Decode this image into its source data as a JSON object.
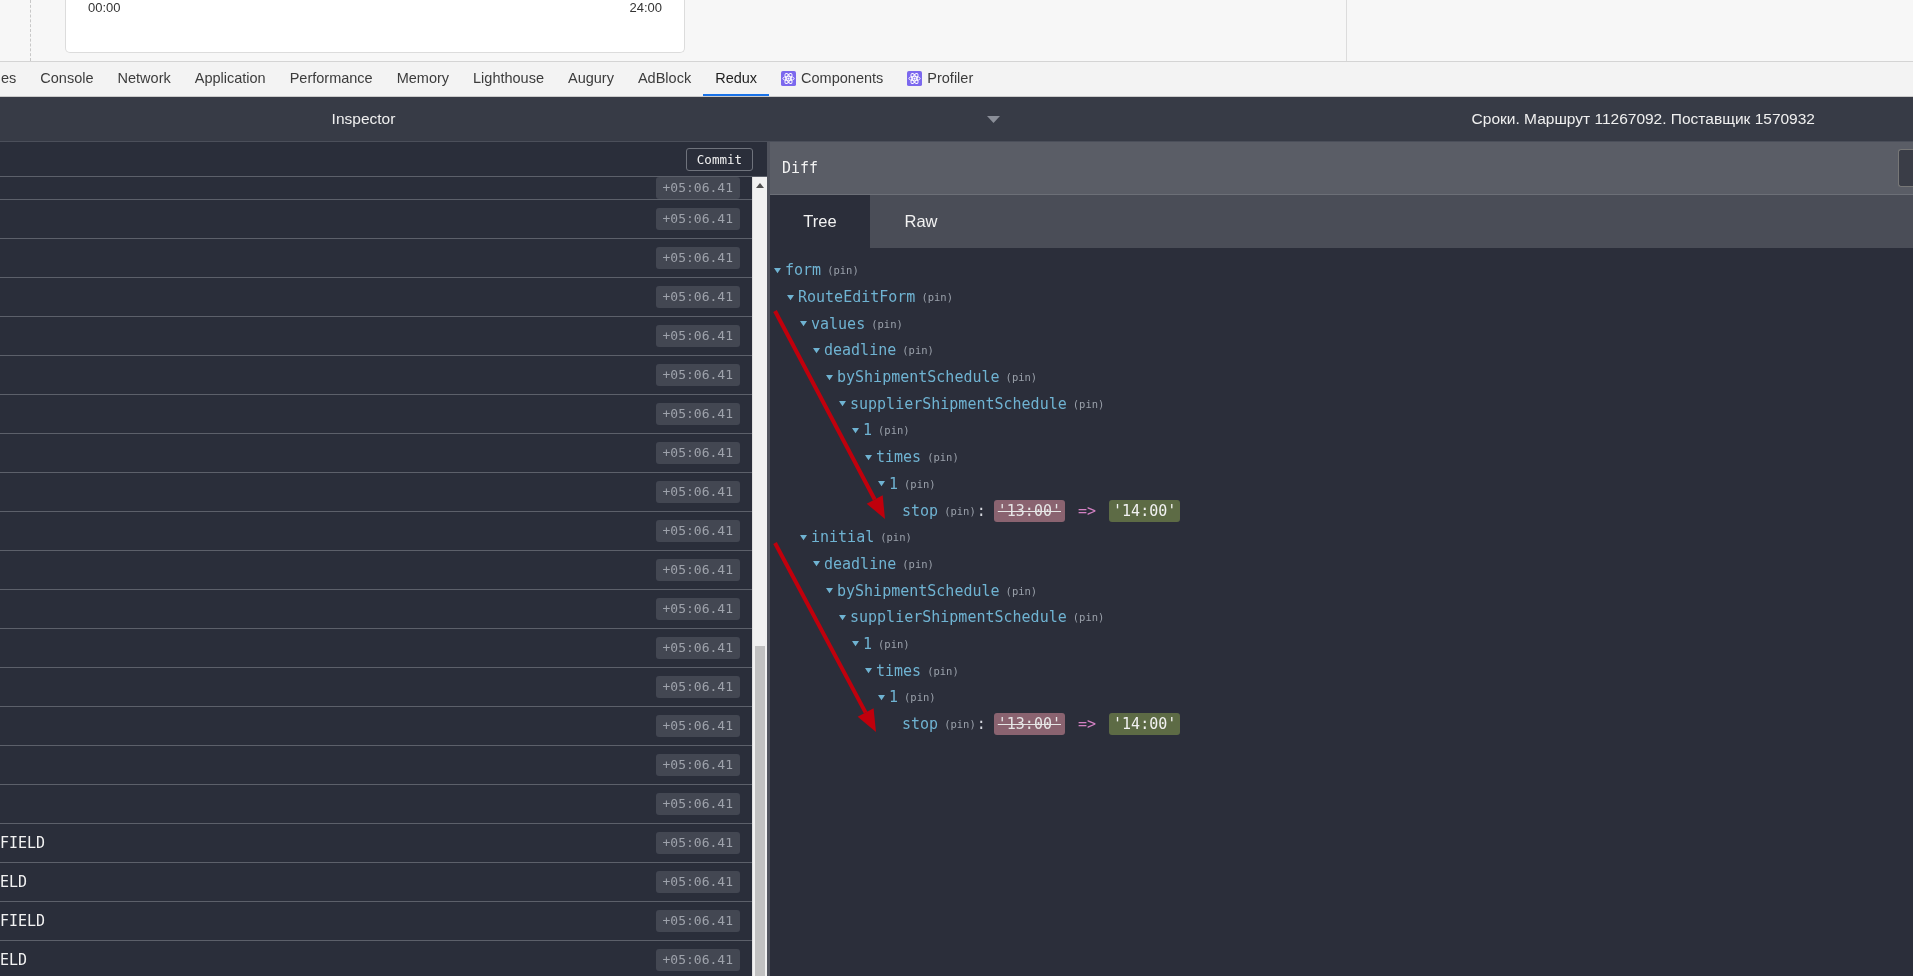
{
  "timeline": {
    "start": "00:00",
    "end": "24:00"
  },
  "devtools_tabs": [
    {
      "label": "es",
      "selected": false
    },
    {
      "label": "Console",
      "selected": false
    },
    {
      "label": "Network",
      "selected": false
    },
    {
      "label": "Application",
      "selected": false
    },
    {
      "label": "Performance",
      "selected": false
    },
    {
      "label": "Memory",
      "selected": false
    },
    {
      "label": "Lighthouse",
      "selected": false
    },
    {
      "label": "Augury",
      "selected": false
    },
    {
      "label": "AdBlock",
      "selected": false
    },
    {
      "label": "Redux",
      "selected": true
    },
    {
      "label": "Components",
      "selected": false,
      "kind": "react"
    },
    {
      "label": "Profiler",
      "selected": false,
      "kind": "react"
    }
  ],
  "inspector": {
    "title": "Inspector",
    "action_title": "Сроки. Маршрут 11267092. Поставщик 1570932"
  },
  "commit_button": "Commit",
  "actions": [
    {
      "time": "+05:06.41"
    },
    {
      "time": "+05:06.41"
    },
    {
      "time": "+05:06.41"
    },
    {
      "time": "+05:06.41"
    },
    {
      "time": "+05:06.41"
    },
    {
      "time": "+05:06.41"
    },
    {
      "time": "+05:06.41"
    },
    {
      "time": "+05:06.41"
    },
    {
      "time": "+05:06.41"
    },
    {
      "time": "+05:06.41"
    },
    {
      "time": "+05:06.41"
    },
    {
      "time": "+05:06.41"
    },
    {
      "time": "+05:06.41"
    },
    {
      "time": "+05:06.41"
    },
    {
      "time": "+05:06.41"
    },
    {
      "time": "+05:06.41"
    },
    {
      "time": "+05:06.41"
    },
    {
      "label": "FIELD",
      "time": "+05:06.41"
    },
    {
      "label": "ELD",
      "time": "+05:06.41"
    },
    {
      "label": "FIELD",
      "time": "+05:06.41"
    },
    {
      "label": "ELD",
      "time": "+05:06.41"
    }
  ],
  "diff": {
    "title": "Diff",
    "tabs": [
      {
        "label": "Tree",
        "selected": true
      },
      {
        "label": "Raw",
        "selected": false
      }
    ],
    "tree": [
      {
        "key": "form",
        "pin": "(pin)",
        "expanded": true,
        "children": [
          {
            "key": "RouteEditForm",
            "pin": "(pin)",
            "expanded": true,
            "children": [
              {
                "key": "values",
                "pin": "(pin)",
                "expanded": true,
                "children": [
                  {
                    "key": "deadline",
                    "pin": "(pin)",
                    "expanded": true,
                    "children": [
                      {
                        "key": "byShipmentSchedule",
                        "pin": "(pin)",
                        "expanded": true,
                        "children": [
                          {
                            "key": "supplierShipmentSchedule",
                            "pin": "(pin)",
                            "expanded": true,
                            "children": [
                              {
                                "key": "1",
                                "pin": "(pin)",
                                "expanded": true,
                                "children": [
                                  {
                                    "key": "times",
                                    "pin": "(pin)",
                                    "expanded": true,
                                    "children": [
                                      {
                                        "key": "1",
                                        "pin": "(pin)",
                                        "expanded": true,
                                        "children": [
                                          {
                                            "key": "stop",
                                            "pin": "(pin)",
                                            "separator": ":",
                                            "old": "'13:00'",
                                            "arrow": "=>",
                                            "new": "'14:00'"
                                          }
                                        ]
                                      }
                                    ]
                                  }
                                ]
                              }
                            ]
                          }
                        ]
                      }
                    ]
                  }
                ]
              },
              {
                "key": "initial",
                "pin": "(pin)",
                "expanded": true,
                "children": [
                  {
                    "key": "deadline",
                    "pin": "(pin)",
                    "expanded": true,
                    "children": [
                      {
                        "key": "byShipmentSchedule",
                        "pin": "(pin)",
                        "expanded": true,
                        "children": [
                          {
                            "key": "supplierShipmentSchedule",
                            "pin": "(pin)",
                            "expanded": true,
                            "children": [
                              {
                                "key": "1",
                                "pin": "(pin)",
                                "expanded": true,
                                "children": [
                                  {
                                    "key": "times",
                                    "pin": "(pin)",
                                    "expanded": true,
                                    "children": [
                                      {
                                        "key": "1",
                                        "pin": "(pin)",
                                        "expanded": true,
                                        "children": [
                                          {
                                            "key": "stop",
                                            "pin": "(pin)",
                                            "separator": ":",
                                            "old": "'13:00'",
                                            "arrow": "=>",
                                            "new": "'14:00'"
                                          }
                                        ]
                                      }
                                    ]
                                  }
                                ]
                              }
                            ]
                          }
                        ]
                      }
                    ]
                  }
                ]
              }
            ]
          }
        ]
      }
    ]
  }
}
